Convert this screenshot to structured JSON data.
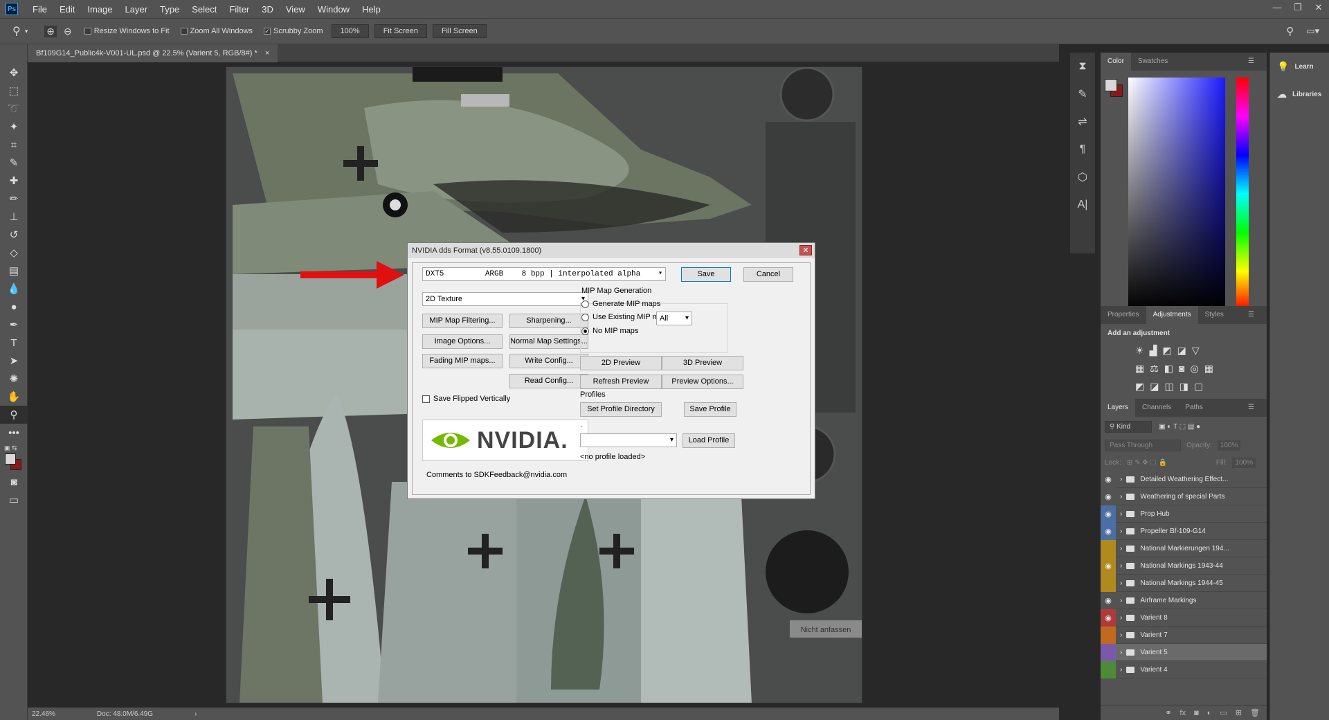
{
  "menubar": {
    "logo": "Ps",
    "items": [
      "File",
      "Edit",
      "Image",
      "Layer",
      "Type",
      "Select",
      "Filter",
      "3D",
      "View",
      "Window",
      "Help"
    ],
    "window_controls": [
      "—",
      "❐",
      "✕"
    ]
  },
  "options": {
    "resize_windows": "Resize Windows to Fit",
    "zoom_all": "Zoom All Windows",
    "scrubby_zoom": "Scrubby Zoom",
    "zoom_100": "100%",
    "fit_screen": "Fit Screen",
    "fill_screen": "Fill Screen"
  },
  "document": {
    "tab_title": "Bf109G14_Public4k-V001-UL.psd @ 22.5% (Varient 5, RGB/8#) *",
    "close": "×",
    "image_text": "Nicht anfassen"
  },
  "status": {
    "zoom": "22.46%",
    "doc": "Doc: 48.0M/6.49G",
    "arrow": "›"
  },
  "right_panel": {
    "color_tabs": [
      "Color",
      "Swatches"
    ],
    "prop_tabs": [
      "Properties",
      "Adjustments",
      "Styles"
    ],
    "add_adjustment": "Add an adjustment",
    "layer_tabs": [
      "Layers",
      "Channels",
      "Paths"
    ],
    "kind": "Kind",
    "blend": "Pass Through",
    "opacity_label": "Opacity:",
    "opacity": "100%",
    "lock_label": "Lock:",
    "fill_label": "Fill:",
    "fill": "100%",
    "layers": [
      {
        "name": "Detailed Weathering Effect...",
        "color": "#535353",
        "visible": true
      },
      {
        "name": "Weathering of special Parts",
        "color": "#535353",
        "visible": true
      },
      {
        "name": "Prop Hub",
        "color": "#4a6fa5",
        "visible": true
      },
      {
        "name": "Propeller Bf-109-G14",
        "color": "#4a6fa5",
        "visible": true
      },
      {
        "name": "National Markierungen 194...",
        "color": "#b08a1e",
        "visible": false
      },
      {
        "name": "National Markings 1943-44",
        "color": "#b08a1e",
        "visible": true
      },
      {
        "name": "National Markings 1944-45",
        "color": "#b08a1e",
        "visible": false
      },
      {
        "name": "Airframe Markings",
        "color": "#535353",
        "visible": true
      },
      {
        "name": "Varient 8",
        "color": "#b03a3a",
        "visible": true
      },
      {
        "name": "Varient 7",
        "color": "#c06a20",
        "visible": false
      },
      {
        "name": "Varient 5",
        "color": "#7a5aa8",
        "visible": false,
        "selected": true
      },
      {
        "name": "Varient 4",
        "color": "#4f8a3a",
        "visible": false
      }
    ]
  },
  "learn": {
    "learn": "Learn",
    "libraries": "Libraries"
  },
  "dialog": {
    "title": "NVIDIA dds Format (v8.55.0109.1800)",
    "close": "✕",
    "format": "DXT5         ARGB    8 bpp | interpolated alpha",
    "save": "Save",
    "cancel": "Cancel",
    "texture_type": "2D Texture",
    "mip_filtering": "MIP Map Filtering...",
    "sharpening": "Sharpening...",
    "image_options": "Image Options...",
    "normal_map": "Normal Map Settings...",
    "fading_mip": "Fading MIP maps...",
    "write_config": "Write Config...",
    "read_config": "Read Config...",
    "save_flipped": "Save Flipped Vertically",
    "mip_group": "MIP Map Generation",
    "generate_mip": "Generate MIP maps",
    "use_existing": "Use Existing MIP maps",
    "all": "All",
    "no_mip": "No MIP maps",
    "preview_2d": "2D Preview",
    "preview_3d": "3D Preview",
    "refresh_preview": "Refresh Preview",
    "preview_options": "Preview Options...",
    "profiles": "Profiles",
    "set_profile_dir": "Set Profile Directory",
    "save_profile": "Save Profile",
    "dot": ".",
    "load_profile": "Load Profile",
    "no_profile": "<no profile loaded>",
    "nvidia": "NVIDIA.",
    "comments": "Comments to SDKFeedback@nvidia.com"
  },
  "colors": {
    "accent": "#31a8ff",
    "arrow": "#e01010",
    "fg_swatch": "#d8d8d8",
    "bg_swatch": "#8a1a1a"
  }
}
